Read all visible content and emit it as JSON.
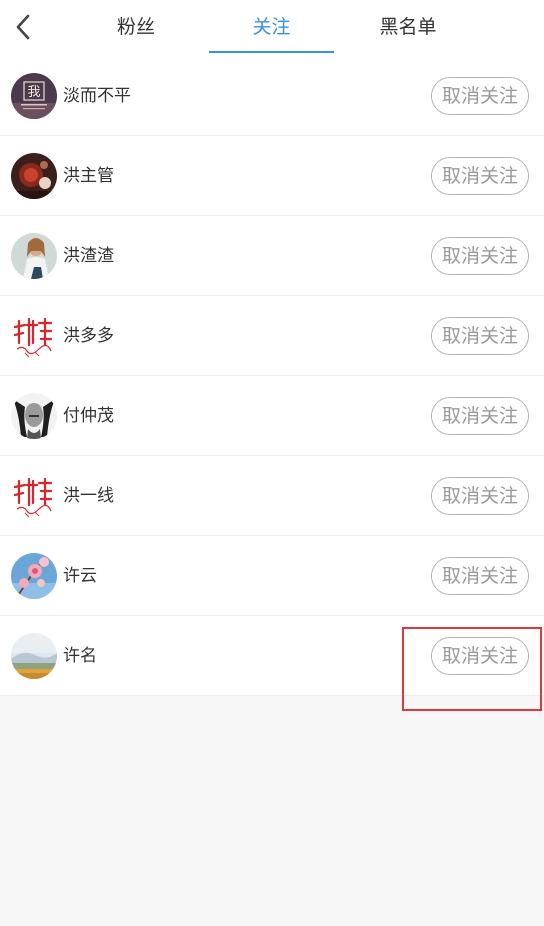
{
  "header": {
    "tabs": [
      {
        "label": "粉丝",
        "active": false
      },
      {
        "label": "关注",
        "active": true
      },
      {
        "label": "黑名单",
        "active": false
      }
    ],
    "accent_color": "#3d8ee6"
  },
  "icons": {
    "back": "chevron-left-icon"
  },
  "follow_list": [
    {
      "name": "淡而不平",
      "action_label": "取消关注",
      "avatar_text": "我"
    },
    {
      "name": "洪主管",
      "action_label": "取消关注"
    },
    {
      "name": "洪渣渣",
      "action_label": "取消关注"
    },
    {
      "name": "洪多多",
      "action_label": "取消关注"
    },
    {
      "name": "付仲茂",
      "action_label": "取消关注"
    },
    {
      "name": "洪一线",
      "action_label": "取消关注"
    },
    {
      "name": "许云",
      "action_label": "取消关注"
    },
    {
      "name": "许名",
      "action_label": "取消关注"
    }
  ],
  "highlight_color": "#e2383c"
}
